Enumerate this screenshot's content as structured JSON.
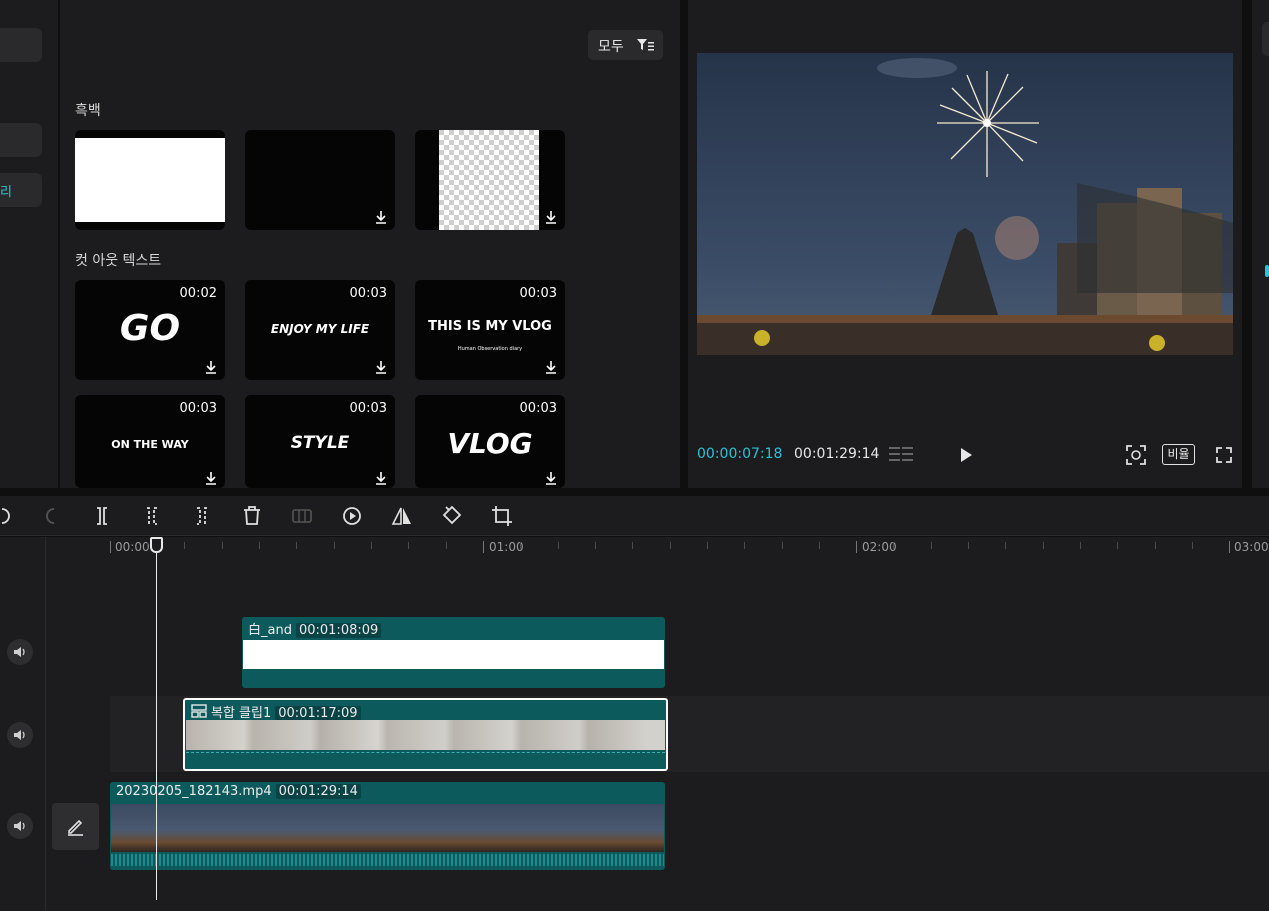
{
  "media": {
    "filter_label": "모두",
    "sections": [
      {
        "title": "흑백"
      },
      {
        "title": "컷 아웃 텍스트"
      }
    ],
    "cutout_items": [
      {
        "title": "GO",
        "duration": "00:02"
      },
      {
        "title": "ENJOY MY LIFE",
        "duration": "00:03"
      },
      {
        "title": "THIS IS MY VLOG",
        "subtitle": "Human Observation diary",
        "duration": "00:03"
      },
      {
        "title": "ON THE WAY",
        "duration": "00:03"
      },
      {
        "title": "STYLE",
        "duration": "00:03"
      },
      {
        "title": "VLOG",
        "duration": "00:03"
      }
    ]
  },
  "sidebar": {
    "active_label": "리"
  },
  "player": {
    "current_time": "00:00:07:18",
    "total_time": "00:01:29:14",
    "ratio_label": "비율"
  },
  "timeline": {
    "ruler": [
      "00:00",
      "01:00",
      "02:00",
      "03:00"
    ],
    "playhead_fraction": 0.0487,
    "clips": {
      "white": {
        "name": "白_and",
        "duration": "00:01:08:09"
      },
      "compound": {
        "name": "복합 클립1",
        "duration": "00:01:17:09"
      },
      "video": {
        "name": "20230205_182143.mp4",
        "duration": "00:01:29:14"
      }
    }
  },
  "colors": {
    "accent": "#29c3d6",
    "clip_teal": "#0c5a5c",
    "panel": "#1c1c1e"
  }
}
